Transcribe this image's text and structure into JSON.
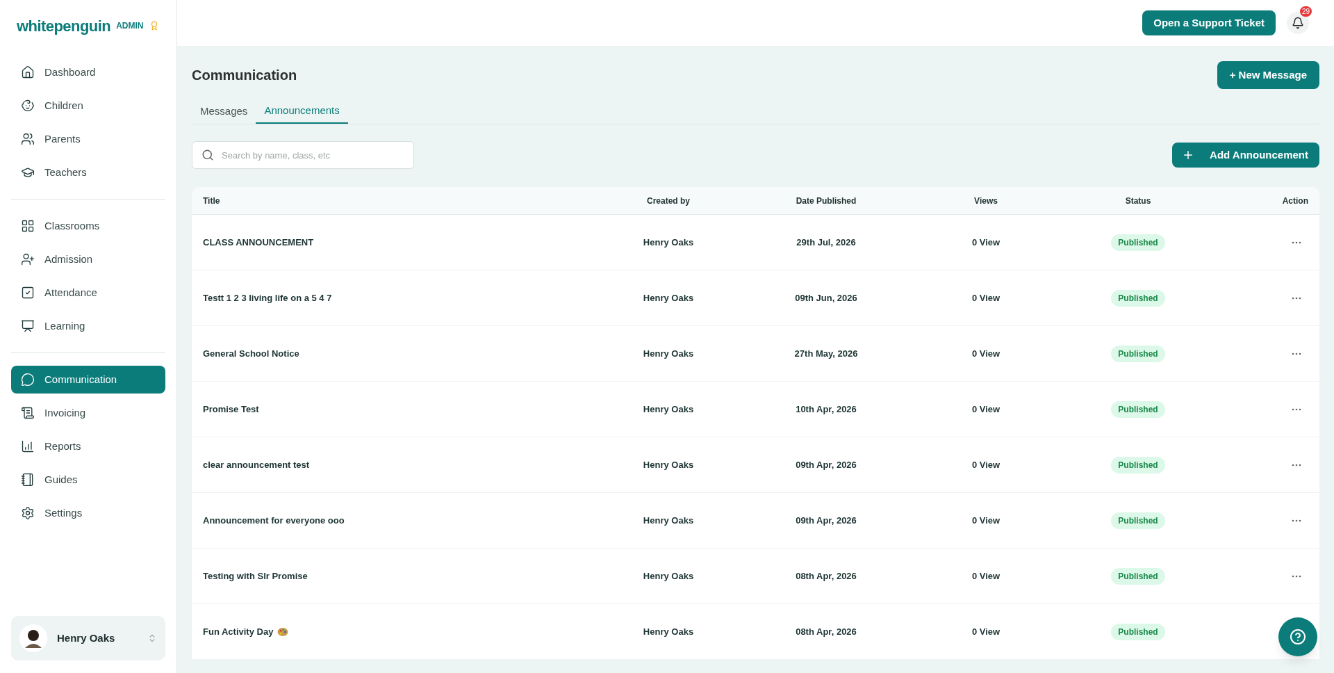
{
  "logo": {
    "name": "whitepenguin",
    "badge": "ADMIN"
  },
  "sidebar": {
    "groups": [
      [
        {
          "label": "Dashboard",
          "selected": false
        },
        {
          "label": "Children",
          "selected": false
        },
        {
          "label": "Parents",
          "selected": false
        },
        {
          "label": "Teachers",
          "selected": false
        }
      ],
      [
        {
          "label": "Classrooms",
          "selected": false
        },
        {
          "label": "Admission",
          "selected": false
        },
        {
          "label": "Attendance",
          "selected": false
        },
        {
          "label": "Learning",
          "selected": false
        }
      ],
      [
        {
          "label": "Communication",
          "selected": true
        },
        {
          "label": "Invoicing",
          "selected": false
        },
        {
          "label": "Reports",
          "selected": false
        },
        {
          "label": "Guides",
          "selected": false
        },
        {
          "label": "Settings",
          "selected": false
        }
      ]
    ],
    "user": {
      "name": "Henry Oaks"
    }
  },
  "header": {
    "support_button": "Open a Support Ticket",
    "notifications": "29"
  },
  "page": {
    "title": "Communication",
    "new_button": "+ New Message",
    "tabs": [
      {
        "label": "Messages",
        "selected": false
      },
      {
        "label": "Announcements",
        "selected": true
      }
    ],
    "search": {
      "placeholder": "Search by name, class, etc"
    },
    "add_button": "Add Announcement",
    "table": {
      "columns": [
        "Title",
        "Created by",
        "Date Published",
        "Views",
        "Status",
        "Action"
      ],
      "rows": [
        {
          "title": "CLASS ANNOUNCEMENT",
          "created_by": "Henry Oaks",
          "date": "29th Jul, 2026",
          "views": "0 View",
          "status": "Published"
        },
        {
          "title": "Testt 1 2 3 living life on a 5 4 7",
          "created_by": "Henry Oaks",
          "date": "09th Jun, 2026",
          "views": "0 View",
          "status": "Published"
        },
        {
          "title": "General School Notice",
          "created_by": "Henry Oaks",
          "date": "27th May, 2026",
          "views": "0 View",
          "status": "Published"
        },
        {
          "title": "Promise Test",
          "created_by": "Henry Oaks",
          "date": "10th Apr, 2026",
          "views": "0 View",
          "status": "Published"
        },
        {
          "title": "clear announcement test",
          "created_by": "Henry Oaks",
          "date": "09th Apr, 2026",
          "views": "0 View",
          "status": "Published"
        },
        {
          "title": "Announcement for everyone ooo",
          "created_by": "Henry Oaks",
          "date": "09th Apr, 2026",
          "views": "0 View",
          "status": "Published"
        },
        {
          "title": "Testing with Slr Promise",
          "created_by": "Henry Oaks",
          "date": "08th Apr, 2026",
          "views": "0 View",
          "status": "Published"
        },
        {
          "title": "Fun Activity Day",
          "kind": "with_icon",
          "created_by": "Henry Oaks",
          "date": "08th Apr, 2026",
          "views": "0 View",
          "status": "Published"
        }
      ]
    }
  }
}
